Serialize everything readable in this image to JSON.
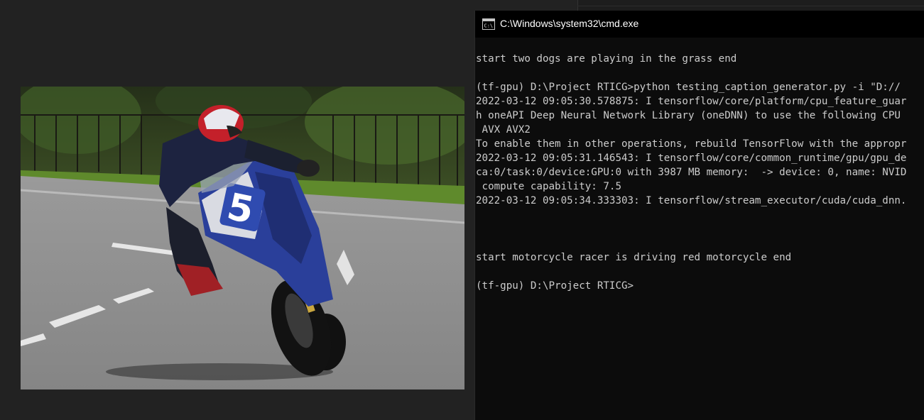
{
  "console": {
    "title": "C:\\Windows\\system32\\cmd.exe",
    "icon": "cmd-icon",
    "lines": [
      "start two dogs are playing in the grass end",
      "",
      "(tf-gpu) D:\\Project RTICG>python testing_caption_generator.py -i \"D://",
      "2022-03-12 09:05:30.578875: I tensorflow/core/platform/cpu_feature_guar",
      "h oneAPI Deep Neural Network Library (oneDNN) to use the following CPU",
      " AVX AVX2",
      "To enable them in other operations, rebuild TensorFlow with the appropr",
      "2022-03-12 09:05:31.146543: I tensorflow/core/common_runtime/gpu/gpu_de",
      "ca:0/task:0/device:GPU:0 with 3987 MB memory:  -> device: 0, name: NVID",
      " compute capability: 7.5",
      "2022-03-12 09:05:34.333303: I tensorflow/stream_executor/cuda/cuda_dnn.",
      "",
      "",
      "",
      "start motorcycle racer is driving red motorcycle end",
      "",
      "(tf-gpu) D:\\Project RTICG>"
    ]
  },
  "photo": {
    "bike_number": "5",
    "colors": {
      "bike_blue": "#2a3f9a",
      "helmet_red": "#c4202a",
      "grass": "#5f8a2c"
    }
  }
}
